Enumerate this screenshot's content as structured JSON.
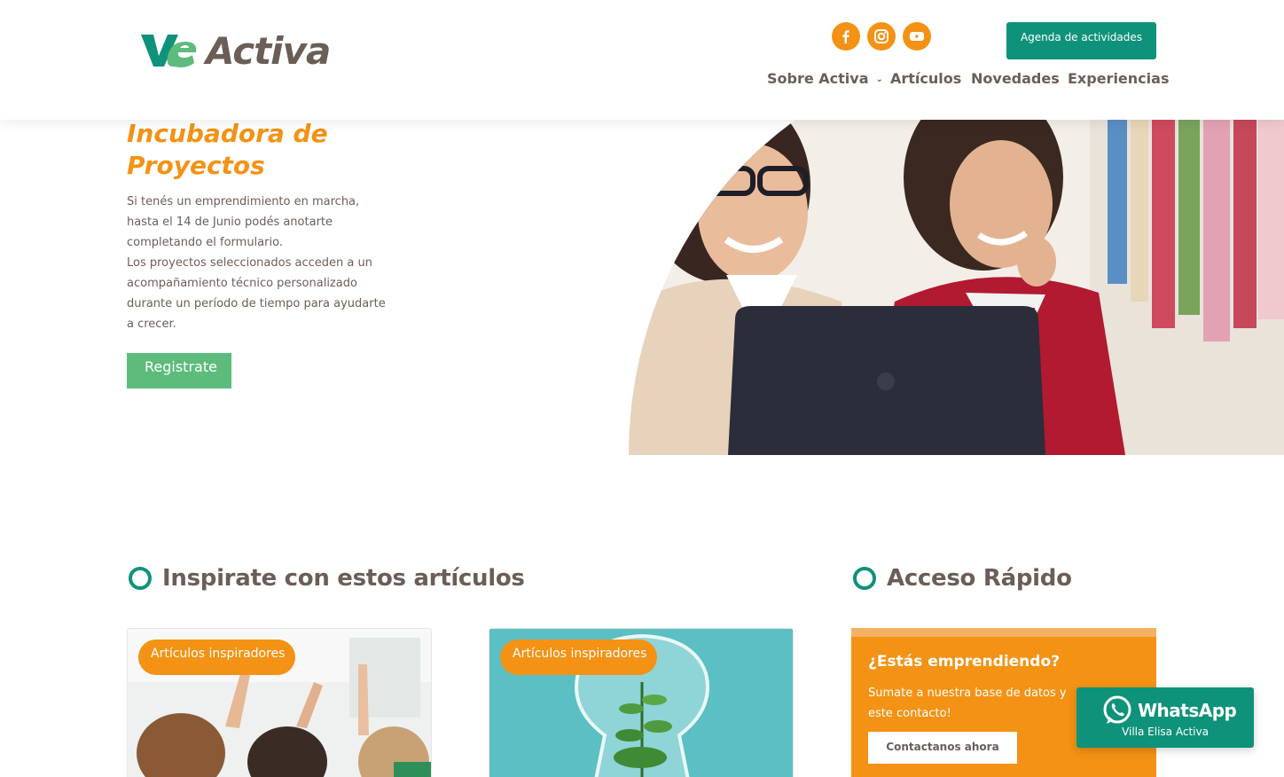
{
  "header": {
    "logo_text": "Activa",
    "logo_mark": "VE",
    "social": [
      {
        "icon": "facebook-icon"
      },
      {
        "icon": "instagram-icon"
      },
      {
        "icon": "youtube-icon"
      }
    ],
    "agenda_label": "Agenda de actividades",
    "nav": [
      {
        "label": "Sobre Activa",
        "has_dropdown": true
      },
      {
        "label": "Artículos"
      },
      {
        "label": "Novedades"
      },
      {
        "label": "Experiencias"
      }
    ]
  },
  "hero": {
    "title": "Incubadora de Proyectos",
    "paragraph_1": "Si tenés un emprendimiento en marcha, hasta el 14 de Junio podés anotarte completando el formulario.",
    "paragraph_2": "Los proyectos seleccionados acceden a un acompañamiento técnico personalizado durante un período de tiempo para ayudarte a crecer.",
    "button_label": "Registrate"
  },
  "articles": {
    "heading": "Inspirate con estos artículos",
    "cards": [
      {
        "tag": "Artículos inspiradores"
      },
      {
        "tag": "Artículos inspiradores"
      }
    ]
  },
  "quick_access": {
    "heading": "Acceso Rápido",
    "card_title": "¿Estás emprendiendo?",
    "card_text": "Sumate a nuestra base de datos y este contacto!",
    "card_button": "Contactanos ahora"
  },
  "whatsapp": {
    "label": "WhatsApp",
    "sublabel": "Villa Elisa Activa"
  },
  "colors": {
    "orange": "#f39214",
    "green": "#0f927a",
    "light_green": "#5dbb7c",
    "text": "#6b5e57"
  }
}
